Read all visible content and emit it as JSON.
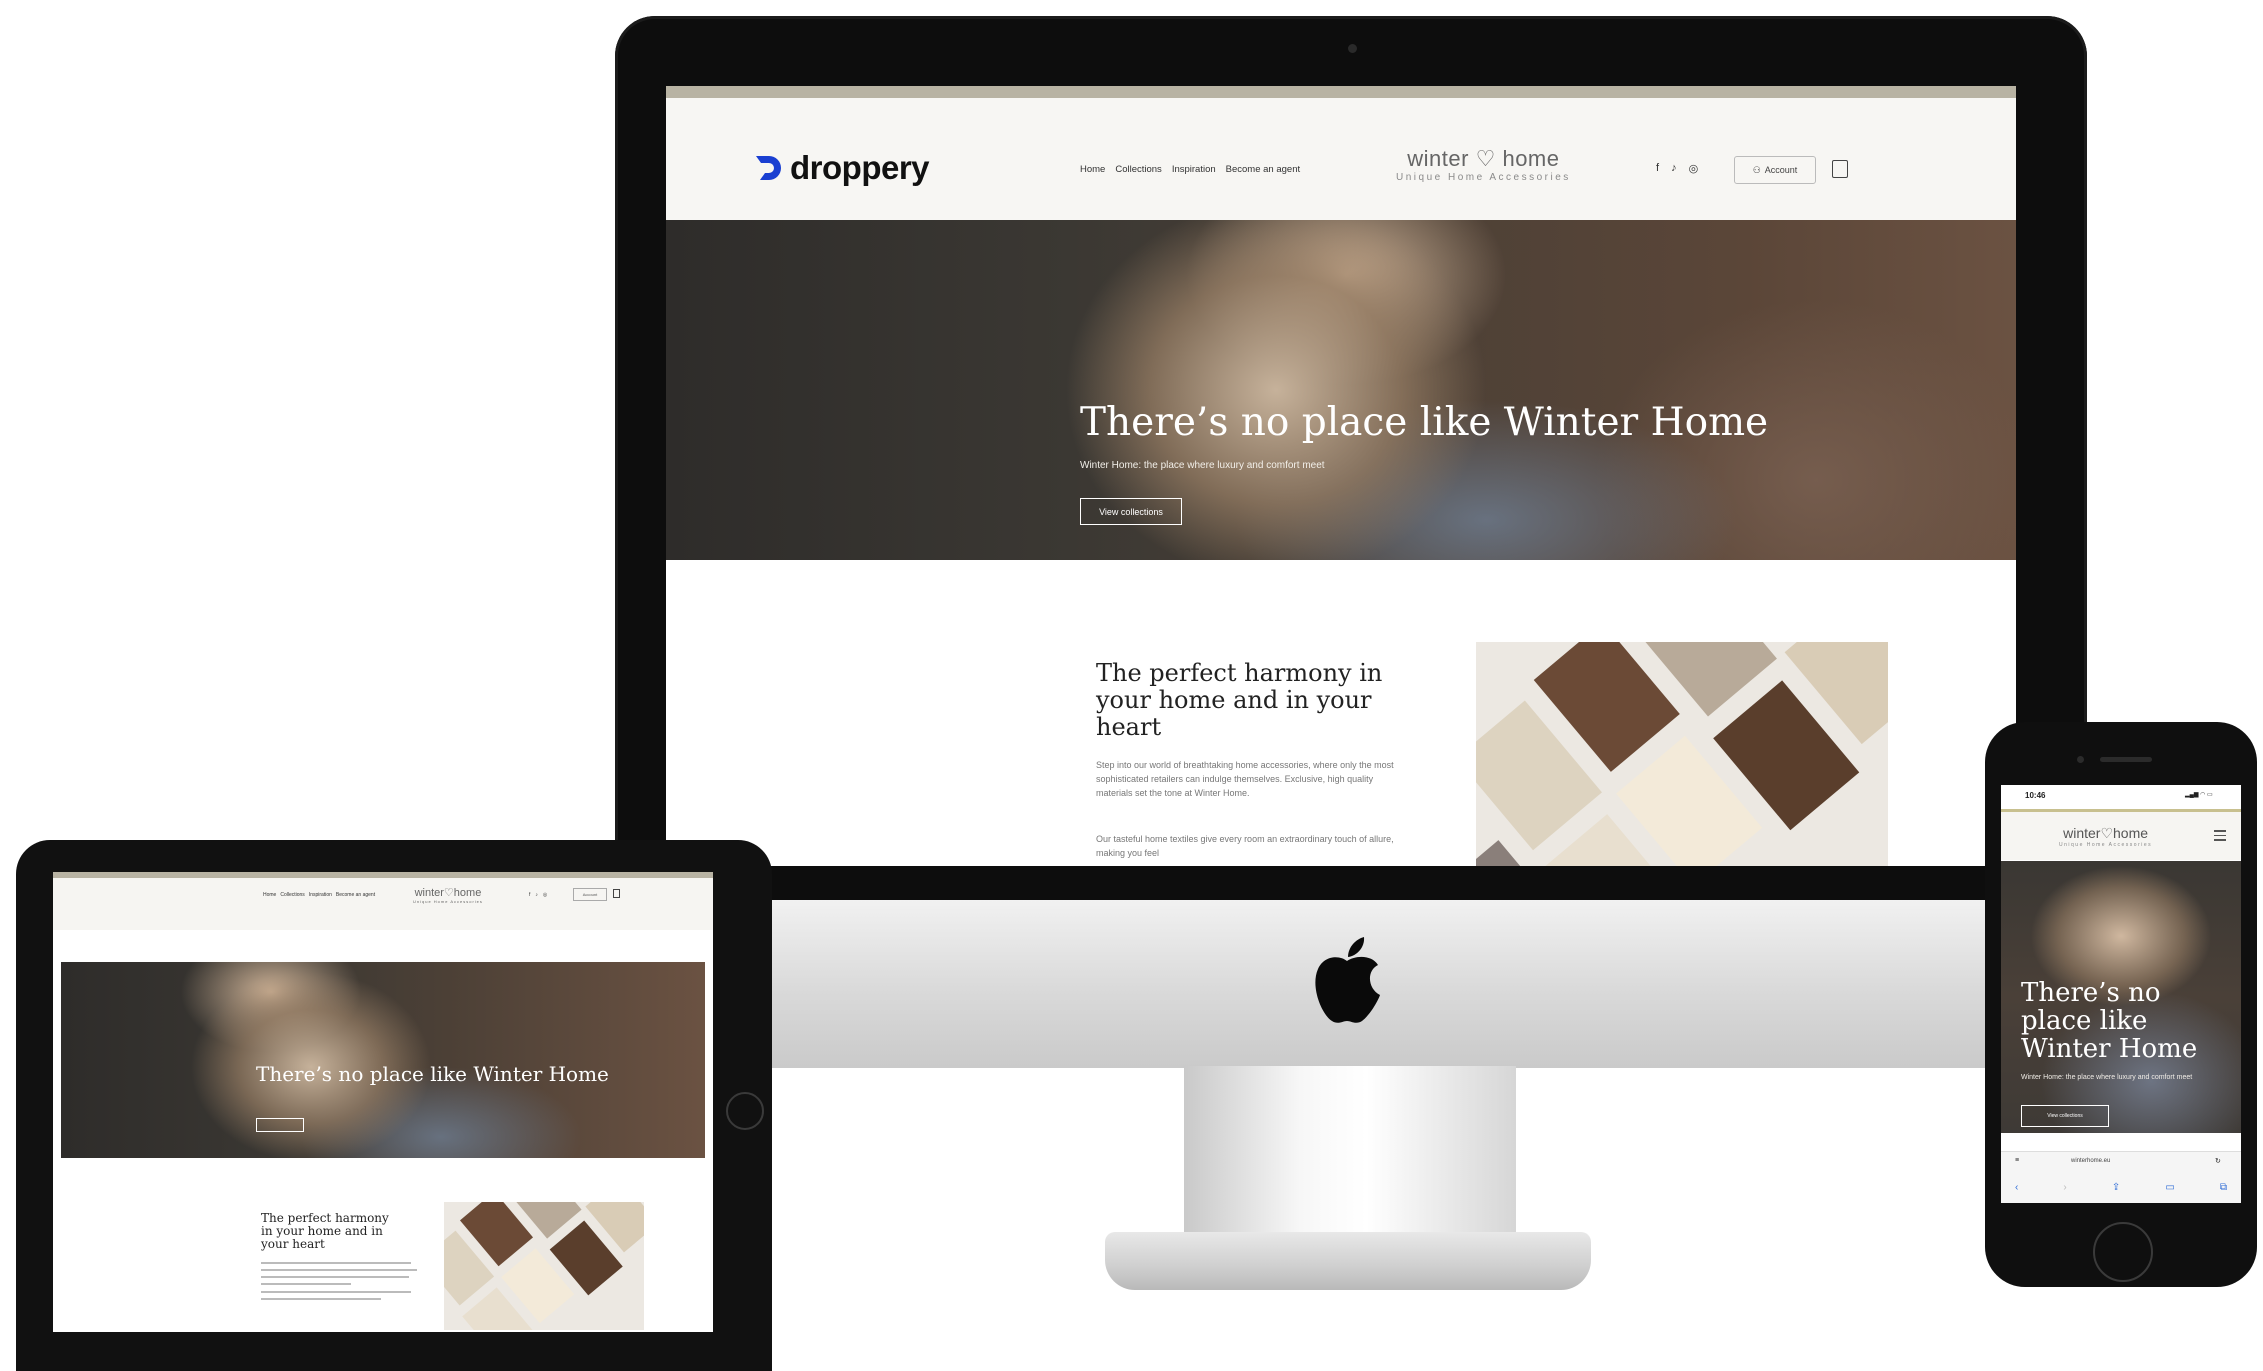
{
  "imac": {
    "site": {
      "logo_text": "droppery",
      "nav": [
        "Home",
        "Collections",
        "Inspiration",
        "Become an agent"
      ],
      "brand_name": "winter",
      "brand_name_2": "home",
      "brand_tagline": "Unique Home Accessories",
      "account_label": "Account",
      "hero_title": "There’s no place like Winter Home",
      "hero_subtitle": "Winter Home: the place where luxury and comfort meet",
      "hero_button": "View collections",
      "section_title": "The perfect harmony in your home and in your heart",
      "section_p1": "Step into our world of breathtaking home accessories, where only the most sophisticated retailers can indulge themselves. Exclusive, high quality materials set the tone at Winter Home.",
      "section_p2": "Our tasteful home textiles give every room an extraordinary touch of allure, making you feel"
    }
  },
  "ipad": {
    "site": {
      "brand_name": "winter",
      "brand_name_2": "home",
      "brand_tagline": "Unique Home Accessories",
      "hero_title": "There’s no place like Winter Home",
      "section_title": "The perfect harmony in your home and in your heart"
    }
  },
  "iphone": {
    "status_time": "10:46",
    "site": {
      "brand_name": "winter",
      "brand_name_2": "home",
      "brand_tagline": "Unique Home Accessories",
      "hero_title": "There’s no place like Winter Home",
      "hero_subtitle": "Winter Home: the place where luxury and comfort meet",
      "hero_button": "View collections",
      "url": "winterhome.eu"
    }
  },
  "colors": {
    "accent_strip": "#b8b3a3",
    "droppery_blue": "#1a3fd1",
    "safari_blue": "#2d6bd6"
  }
}
